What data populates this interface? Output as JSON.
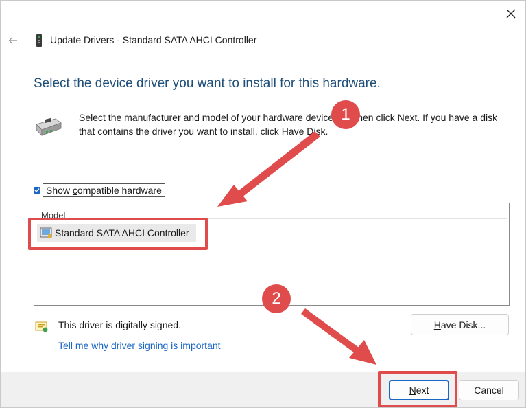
{
  "window": {
    "title": "Update Drivers - Standard SATA AHCI Controller"
  },
  "dialog": {
    "heading": "Select the device driver you want to install for this hardware.",
    "instructions": "Select the manufacturer and model of your hardware device and then click Next. If you have a disk that contains the driver you want to install, click Have Disk.",
    "show_compatible": {
      "label_prefix": "Show ",
      "label_underlined": "c",
      "label_suffix": "ompatible hardware",
      "checked": true
    },
    "model_list": {
      "header": "Model",
      "items": [
        "Standard SATA AHCI Controller"
      ]
    },
    "signed_text": "This driver is digitally signed.",
    "signing_link": "Tell me why driver signing is important",
    "have_disk": {
      "underlined": "H",
      "rest": "ave Disk..."
    }
  },
  "footer": {
    "next": {
      "underlined": "N",
      "rest": "ext"
    },
    "cancel": "Cancel"
  },
  "annotations": {
    "badge1": "1",
    "badge2": "2",
    "color": "#e04b4b"
  },
  "colors": {
    "heading": "#1f4e79",
    "link": "#1a66c4",
    "accent": "#1a66c4",
    "footer_bg": "#f0f0f0"
  }
}
